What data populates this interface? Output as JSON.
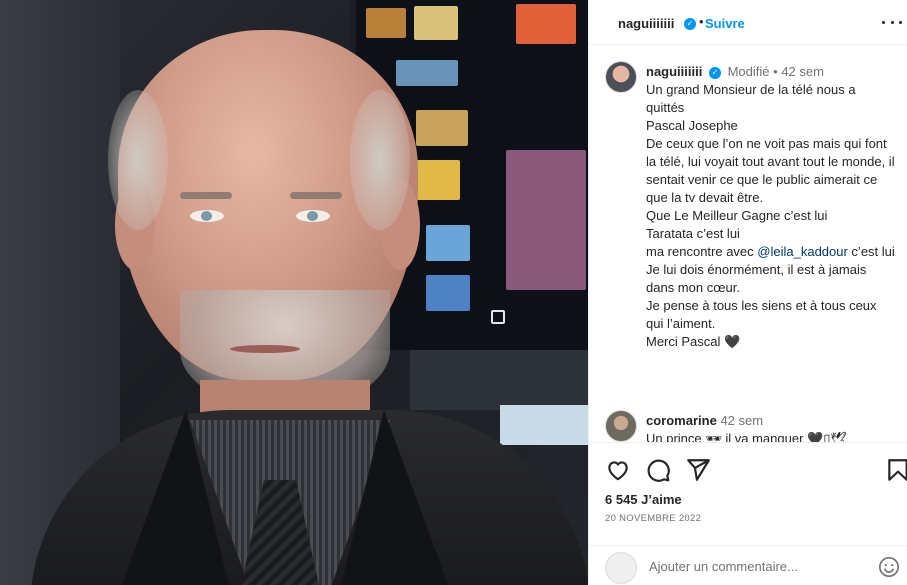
{
  "header": {
    "username": "naguiiiiiii",
    "separator": "•",
    "follow_label": "Suivre"
  },
  "caption": {
    "username": "naguiiiiiii",
    "edited_label": "Modifié",
    "separator": "•",
    "time_ago": "42 sem",
    "lines": [
      "Un grand Monsieur de la télé nous a quittés",
      "Pascal Josephe",
      "De ceux que l’on ne voit pas mais qui font la télé, lui voyait tout avant tout le monde, il sentait venir ce que le public aimerait ce que la tv devait être.",
      "Que Le Meilleur Gagne c’est lui",
      "Taratata c’est lui"
    ],
    "meeting_prefix": "ma rencontre avec ",
    "mention": "@leila_kaddour",
    "meeting_suffix": " c’est lui",
    "lines_after": [
      "Je lui dois énormément, il est à jamais dans mon cœur.",
      "Je pense à tous les siens et à tous ceux qui l’aiment."
    ],
    "closing": "Merci Pascal ",
    "closing_emoji": "🖤"
  },
  "comment": {
    "username": "coromarine",
    "time_ago": "42 sem",
    "text": "Un prince 🕶 il va manquer 🖤▯🕊"
  },
  "actions": {
    "likes": "6 545 J’aime",
    "date": "20 NOVEMBRE 2022"
  },
  "comment_input": {
    "placeholder": "Ajouter un commentaire..."
  },
  "icons": [
    "more-options-icon",
    "verified-badge-icon",
    "heart-icon",
    "comment-icon",
    "share-icon",
    "bookmark-icon",
    "emoji-icon"
  ],
  "colors": {
    "accent": "#0095f6",
    "text": "#262626",
    "secondary": "#737373",
    "mention": "#00376b"
  }
}
